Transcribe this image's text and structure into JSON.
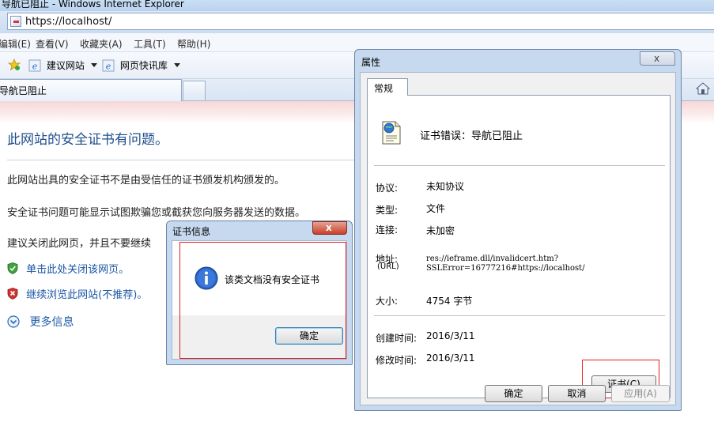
{
  "browser": {
    "window_title": "导航已阻止 - Windows Internet Explorer",
    "address": "https://localhost/",
    "menu": [
      "编辑(E)",
      "查看(V)",
      "收藏夹(A)",
      "工具(T)",
      "帮助(H)"
    ],
    "favorites_bar": [
      "建议网站",
      "网页快讯库"
    ],
    "active_tab": "导航已阻止"
  },
  "page": {
    "heading": "此网站的安全证书有问题。",
    "para1": "此网站出具的安全证书不是由受信任的证书颁发机构颁发的。",
    "para2": "安全证书问题可能显示试图欺骗您或截获您向服务器发送的数据。",
    "para3": "建议关闭此网页，并且不要继续",
    "link_close": "单击此处关闭该网页。",
    "link_continue": "继续浏览此网站(不推荐)。",
    "more_info": "更多信息"
  },
  "properties_dialog": {
    "title": "属性",
    "close": "x",
    "tab": "常规",
    "doc_title": "证书错误：导航已阻止",
    "protocol_label": "协议:",
    "protocol_value": "未知协议",
    "type_label": "类型:",
    "type_value": "文件",
    "connection_label": "连接:",
    "connection_value": "未加密",
    "address_label": "地址:",
    "address_label_sub": "(URL)",
    "address_line1": "res://ieframe.dll/invalidcert.htm?",
    "address_line2": "SSLError=16777216#https://localhost/",
    "size_label": "大小:",
    "size_value": "4754 字节",
    "created_label": "创建时间:",
    "created_value": "2016/3/11",
    "modified_label": "修改时间:",
    "modified_value": "2016/3/11",
    "cert_button": "证书(C)",
    "ok_button": "确定",
    "cancel_button": "取消",
    "apply_button": "应用(A)"
  },
  "cert_dialog": {
    "title": "证书信息",
    "close": "x",
    "message": "该类文档没有安全证书",
    "ok_button": "确定"
  },
  "colors": {
    "highlight_box": "#e0201c",
    "link": "#1a55a5",
    "heading": "#1f4e8c"
  }
}
